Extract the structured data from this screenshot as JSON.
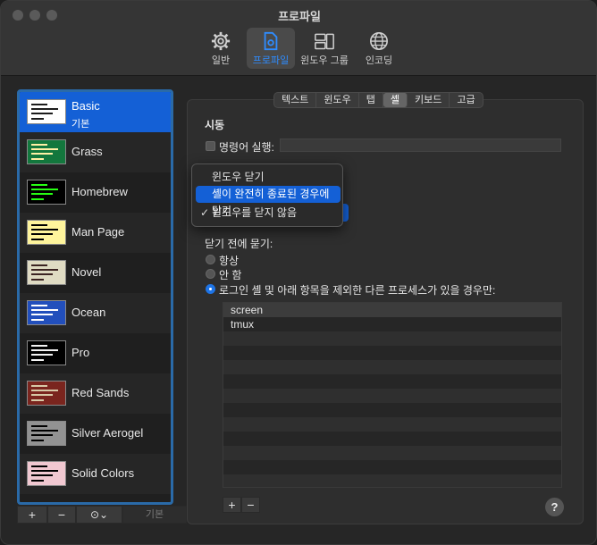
{
  "window": {
    "title": "프로파일"
  },
  "toolbar": {
    "items": [
      {
        "label": "일반",
        "icon": "gear-icon"
      },
      {
        "label": "프로파일",
        "icon": "profile-icon",
        "active": true
      },
      {
        "label": "윈도우 그룹",
        "icon": "window-group-icon"
      },
      {
        "label": "인코딩",
        "icon": "globe-icon"
      }
    ]
  },
  "profiles": {
    "items": [
      {
        "name": "Basic",
        "sub": "기본",
        "thumb_bg": "#ffffff",
        "thumb_fg": "#1c1c1c"
      },
      {
        "name": "Grass",
        "thumb_bg": "#13773d",
        "thumb_fg": "#fff0a5"
      },
      {
        "name": "Homebrew",
        "thumb_bg": "#000000",
        "thumb_fg": "#28fe14"
      },
      {
        "name": "Man Page",
        "thumb_bg": "#fef49c",
        "thumb_fg": "#000000"
      },
      {
        "name": "Novel",
        "thumb_bg": "#dfdbc3",
        "thumb_fg": "#3b2322"
      },
      {
        "name": "Ocean",
        "thumb_bg": "#224fbc",
        "thumb_fg": "#ffffff"
      },
      {
        "name": "Pro",
        "thumb_bg": "#000000",
        "thumb_fg": "#f2f2f2"
      },
      {
        "name": "Red Sands",
        "thumb_bg": "#7a251e",
        "thumb_fg": "#d7c9a7"
      },
      {
        "name": "Silver Aerogel",
        "thumb_bg": "#929292",
        "thumb_fg": "#000000"
      },
      {
        "name": "Solid Colors",
        "thumb_bg": "#f1c8d1",
        "thumb_fg": "#000000"
      }
    ],
    "buttons": {
      "add": "+",
      "remove": "−",
      "more": "⊙⌄",
      "default": "기본"
    }
  },
  "tabs": [
    "텍스트",
    "윈도우",
    "탭",
    "셸",
    "키보드",
    "고급"
  ],
  "shell": {
    "startup_heading": "시동",
    "run_command_label": "명령어 실행:",
    "ask_before_close_heading": "닫기 전에 묻기:",
    "radio_always": "항상",
    "radio_never": "안 함",
    "radio_processes": "로그인 셸 및 아래 항목을 제외한 다른 프로세스가 있을 경우만:"
  },
  "dropdown": {
    "items": [
      "윈도우 닫기",
      "셸이 완전히 종료된 경우에 닫기",
      "윈도우를 닫지 않음"
    ],
    "highlighted_index": 1,
    "checked_index": 2
  },
  "process_table": {
    "rows": [
      "screen",
      "tmux"
    ],
    "add": "+",
    "remove": "−"
  },
  "help": "?",
  "colors": {
    "accent": "#1460d6",
    "list_border": "#2a6aa8"
  }
}
